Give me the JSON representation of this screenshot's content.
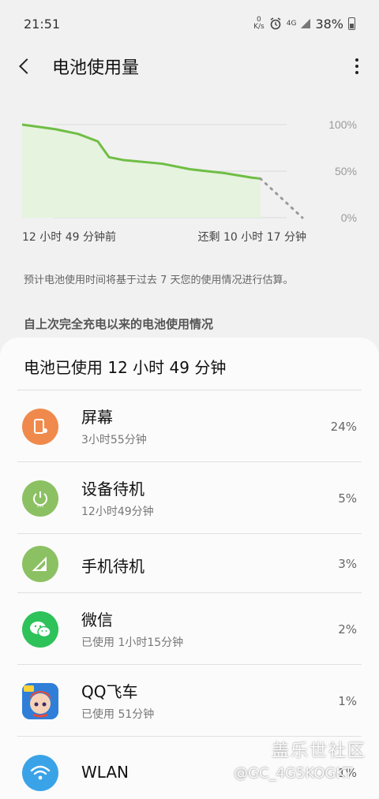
{
  "status_bar": {
    "time": "21:51",
    "speed_value": "0",
    "speed_unit": "K/s",
    "network": "4G",
    "battery": "38%"
  },
  "app_bar": {
    "title": "电池使用量"
  },
  "chart_data": {
    "type": "area",
    "ytick_labels": [
      "100%",
      "50%",
      "0%"
    ],
    "ylim": [
      0,
      100
    ],
    "start_label": "12 小时 49 分钟前",
    "end_label": "还剩 10 小时 17 分钟",
    "history": [
      [
        0,
        100
      ],
      [
        0.05,
        98
      ],
      [
        0.12,
        95
      ],
      [
        0.2,
        90
      ],
      [
        0.27,
        82
      ],
      [
        0.31,
        65
      ],
      [
        0.36,
        62
      ],
      [
        0.5,
        58
      ],
      [
        0.6,
        52
      ],
      [
        0.72,
        48
      ],
      [
        0.82,
        43
      ],
      [
        0.85,
        42
      ]
    ],
    "projection": [
      [
        0.85,
        42
      ],
      [
        1.0,
        0
      ]
    ],
    "line_color": "#6fbe45",
    "fill_color": "#e6f3df",
    "projection_color": "#9a9a9a",
    "grid": true
  },
  "estimate_note": "预计电池使用时间将基于过去 7 天您的使用情况进行估算。",
  "section_header": "自上次完全充电以来的电池使用情况",
  "usage": {
    "summary": "电池已使用 12 小时 49 分钟",
    "items": [
      {
        "name": "屏幕",
        "sub": "3小时55分钟",
        "percent": "24%",
        "icon": "screen-brightness-icon",
        "color": "#ef8a4c"
      },
      {
        "name": "设备待机",
        "sub": "12小时49分钟",
        "percent": "5%",
        "icon": "power-standby-icon",
        "color": "#8cc163"
      },
      {
        "name": "手机待机",
        "sub": "",
        "percent": "3%",
        "icon": "signal-icon",
        "color": "#8cc163"
      },
      {
        "name": "微信",
        "sub": "已使用 1小时15分钟",
        "percent": "2%",
        "icon": "wechat-icon",
        "color": "#2dc25a"
      },
      {
        "name": "QQ飞车",
        "sub": "已使用 51分钟",
        "percent": "1%",
        "icon": "qq-speed-game-icon",
        "color": "#2f7fd8"
      },
      {
        "name": "WLAN",
        "sub": "",
        "percent": "1%",
        "icon": "wifi-icon",
        "color": "#3aa3e8"
      }
    ]
  },
  "watermark": {
    "title": "盖乐世社区",
    "user": "@GC_4G5KOGKT"
  }
}
